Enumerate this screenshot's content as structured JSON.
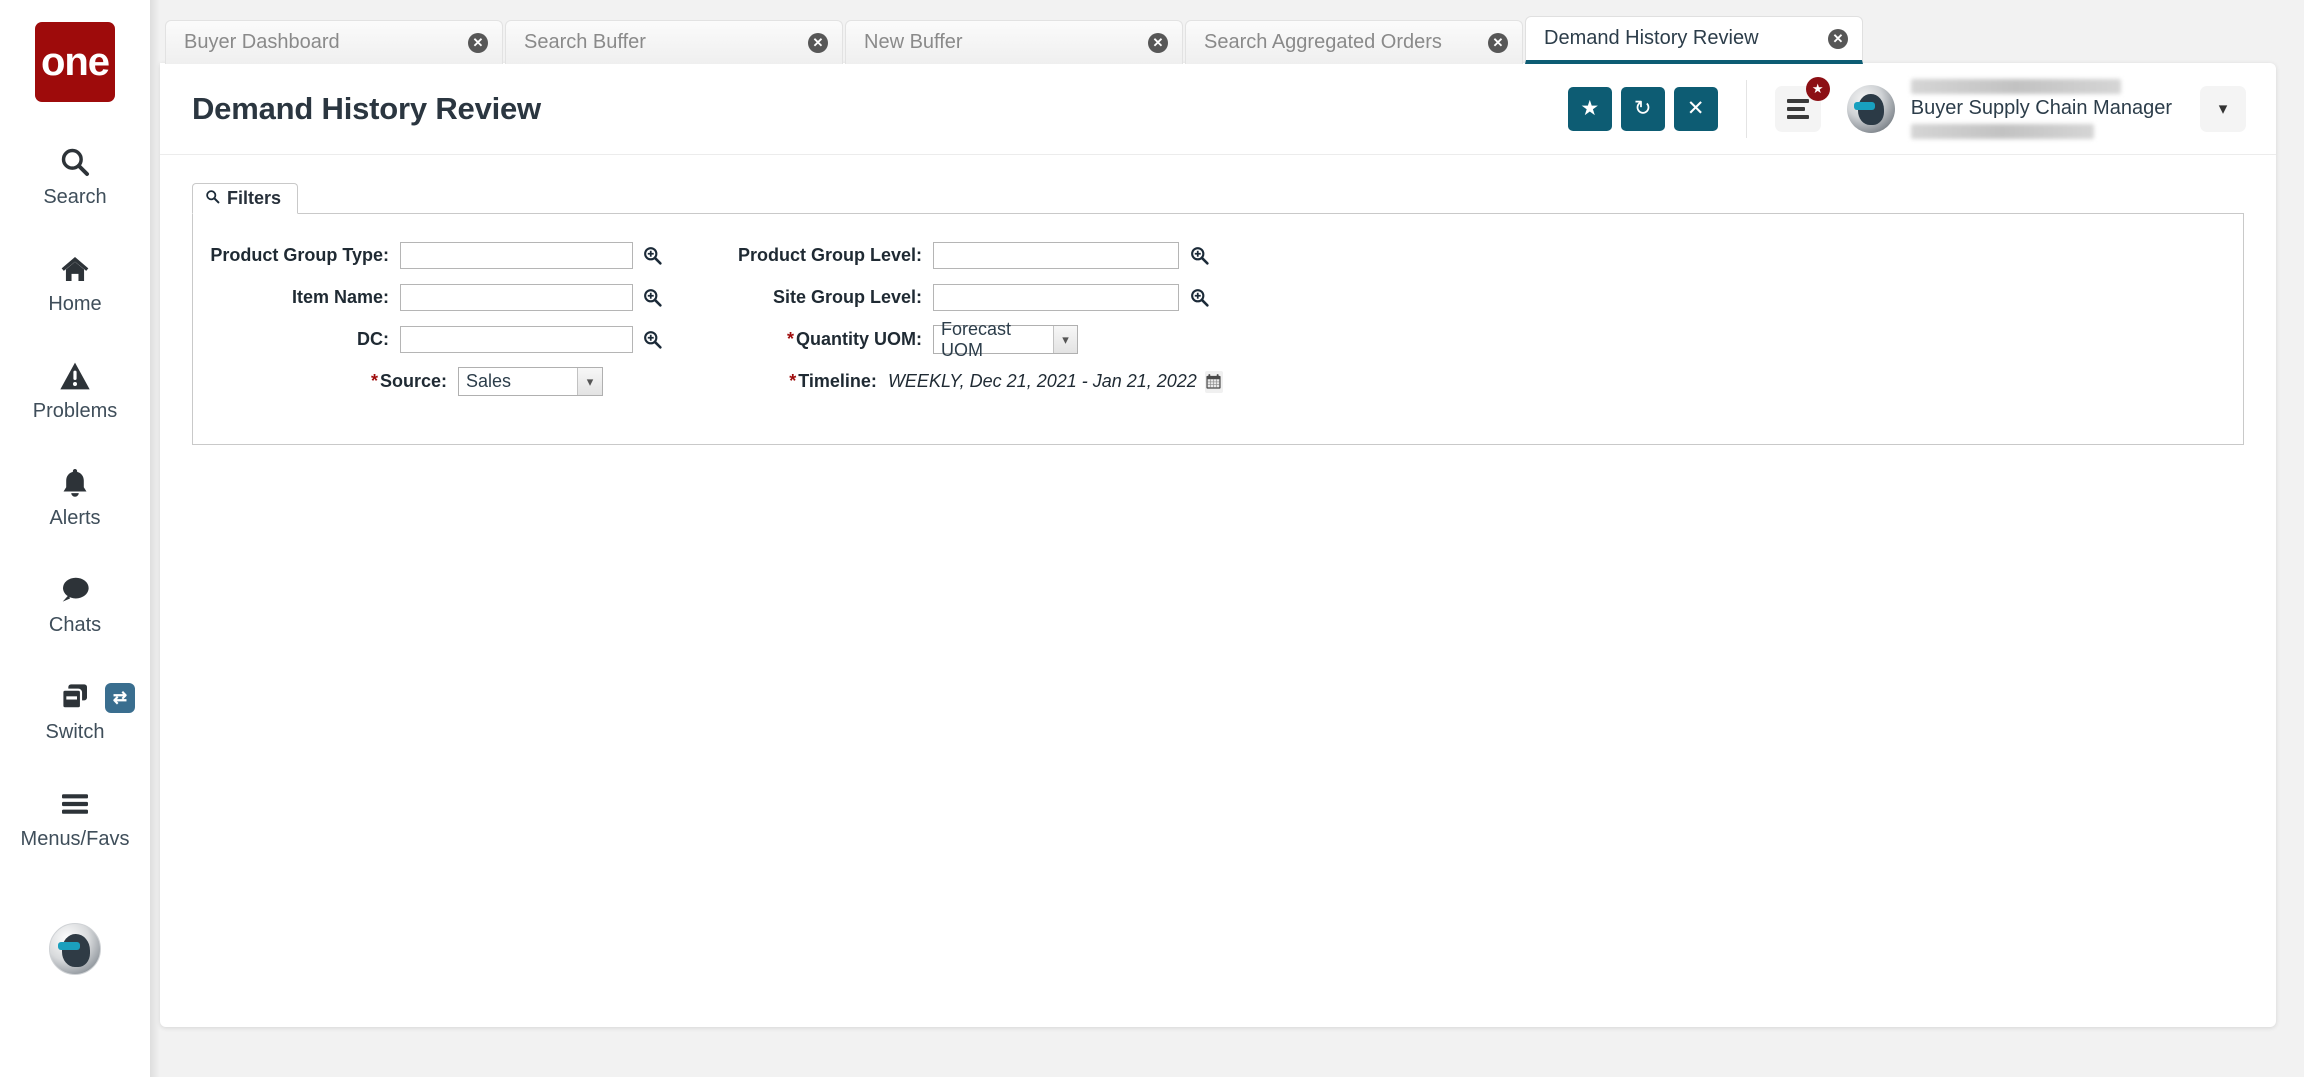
{
  "app": {
    "logo_text": "one",
    "brand_color": "#9e0b0b",
    "accent_color": "#0d5c73"
  },
  "sidebar": {
    "items": [
      {
        "label": "Search",
        "icon": "search-icon"
      },
      {
        "label": "Home",
        "icon": "home-icon"
      },
      {
        "label": "Problems",
        "icon": "warning-triangle-icon"
      },
      {
        "label": "Alerts",
        "icon": "bell-icon"
      },
      {
        "label": "Chats",
        "icon": "chat-bubble-icon"
      },
      {
        "label": "Switch",
        "icon": "windows-icon",
        "badge_icon": "swap-arrows-icon"
      },
      {
        "label": "Menus/Favs",
        "icon": "hamburger-icon"
      }
    ],
    "avatar": "user-avatar-icon"
  },
  "tabs": [
    {
      "label": "Buyer Dashboard",
      "active": false,
      "close_icon": "close-circle-icon"
    },
    {
      "label": "Search Buffer",
      "active": false,
      "close_icon": "close-circle-icon"
    },
    {
      "label": "New Buffer",
      "active": false,
      "close_icon": "close-circle-icon"
    },
    {
      "label": "Search Aggregated Orders",
      "active": false,
      "close_icon": "close-circle-icon"
    },
    {
      "label": "Demand History Review",
      "active": true,
      "close_icon": "close-circle-icon"
    }
  ],
  "header": {
    "title": "Demand History Review",
    "actions": [
      {
        "name": "favorite-button",
        "icon": "star-icon",
        "glyph": "★"
      },
      {
        "name": "refresh-button",
        "icon": "refresh-icon",
        "glyph": "↻"
      },
      {
        "name": "close-button",
        "icon": "x-icon",
        "glyph": "✕"
      }
    ],
    "menu": {
      "icon": "hamburger-menu-icon",
      "badge_icon": "star-badge-icon",
      "badge_glyph": "★"
    },
    "user": {
      "name_redacted": "██████ ██████",
      "role": "Buyer Supply Chain Manager",
      "email_redacted": "██████████",
      "caret_glyph": "▾"
    }
  },
  "filters": {
    "tab_label": "Filters",
    "tab_icon": "search-icon",
    "left_fields": [
      {
        "label": "Product Group Type:",
        "required": false,
        "type": "lookup",
        "value": "",
        "placeholder": "",
        "icon": "magnifier-plus-icon"
      },
      {
        "label": "Item Name:",
        "required": false,
        "type": "lookup",
        "value": "",
        "placeholder": "",
        "icon": "magnifier-plus-icon"
      },
      {
        "label": "DC:",
        "required": false,
        "type": "lookup",
        "value": "",
        "placeholder": "",
        "icon": "magnifier-plus-icon"
      },
      {
        "label": "Source:",
        "required": true,
        "type": "select",
        "value": "Sales",
        "options": [
          "Sales"
        ],
        "icon": "chevron-down-icon"
      }
    ],
    "right_fields": [
      {
        "label": "Product Group Level:",
        "required": false,
        "type": "lookup",
        "value": "",
        "placeholder": "",
        "icon": "magnifier-plus-icon"
      },
      {
        "label": "Site Group Level:",
        "required": false,
        "type": "lookup",
        "value": "",
        "placeholder": "",
        "icon": "magnifier-plus-icon"
      },
      {
        "label": "Quantity UOM:",
        "required": true,
        "type": "select",
        "value": "Forecast UOM",
        "options": [
          "Forecast UOM"
        ],
        "icon": "chevron-down-icon"
      },
      {
        "label": "Timeline:",
        "required": true,
        "type": "datetext",
        "value": "WEEKLY, Dec 21, 2021 - Jan 21, 2022",
        "icon": "calendar-icon"
      }
    ],
    "required_marker": "*"
  }
}
